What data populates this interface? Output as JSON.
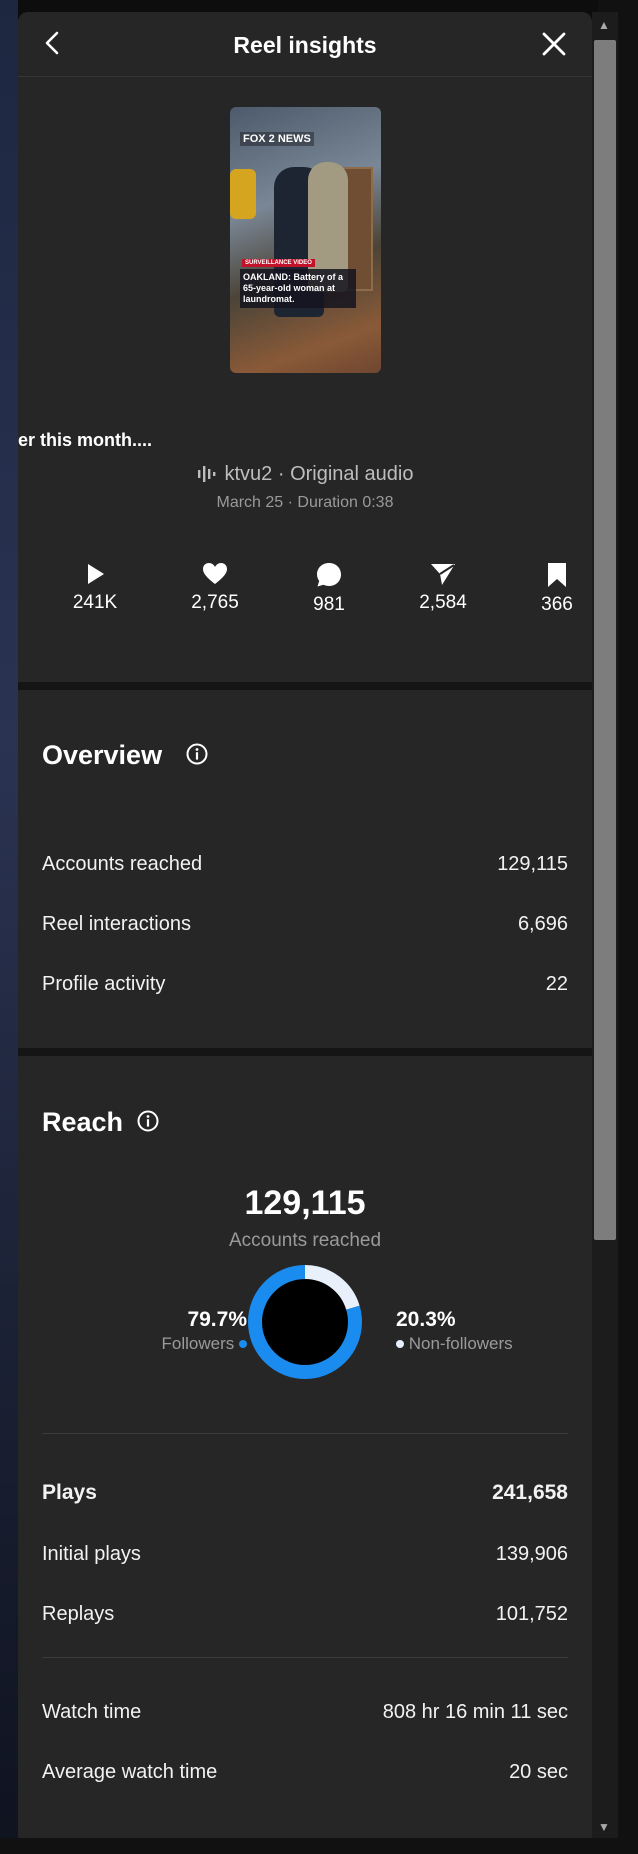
{
  "header": {
    "title": "Reel insights",
    "back_icon": "chevron-left-icon",
    "close_icon": "close-icon"
  },
  "reel": {
    "thumbnail": {
      "logo": "FOX 2 NEWS",
      "tag": "SURVEILLANCE VIDEO",
      "caption": "OAKLAND: Battery of a 65-year-old woman at laundromat."
    },
    "description": "er this month....",
    "audio": "ktvu2 · Original audio",
    "date_duration": "March 25 · Duration 0:38"
  },
  "stats": [
    {
      "icon": "play-icon",
      "value": "241K"
    },
    {
      "icon": "heart-icon",
      "value": "2,765"
    },
    {
      "icon": "comment-icon",
      "value": "981"
    },
    {
      "icon": "share-icon",
      "value": "2,584"
    },
    {
      "icon": "bookmark-icon",
      "value": "366"
    }
  ],
  "overview": {
    "title": "Overview",
    "rows": [
      {
        "label": "Accounts reached",
        "value": "129,115"
      },
      {
        "label": "Reel interactions",
        "value": "6,696"
      },
      {
        "label": "Profile activity",
        "value": "22"
      }
    ]
  },
  "reach": {
    "title": "Reach",
    "accounts_reached": "129,115",
    "accounts_reached_label": "Accounts reached",
    "followers_pct": "79.7%",
    "followers_label": "Followers",
    "non_followers_pct": "20.3%",
    "non_followers_label": "Non-followers",
    "followers_fraction": 0.797,
    "colors": {
      "followers": "#1a8cf0",
      "non_followers": "#e8f1fb"
    }
  },
  "plays": {
    "rows": [
      {
        "label": "Plays",
        "value": "241,658"
      },
      {
        "label": "Initial plays",
        "value": "139,906"
      },
      {
        "label": "Replays",
        "value": "101,752"
      }
    ]
  },
  "watch": {
    "rows": [
      {
        "label": "Watch time",
        "value": "808 hr 16 min 11 sec"
      },
      {
        "label": "Average watch time",
        "value": "20 sec"
      }
    ]
  }
}
